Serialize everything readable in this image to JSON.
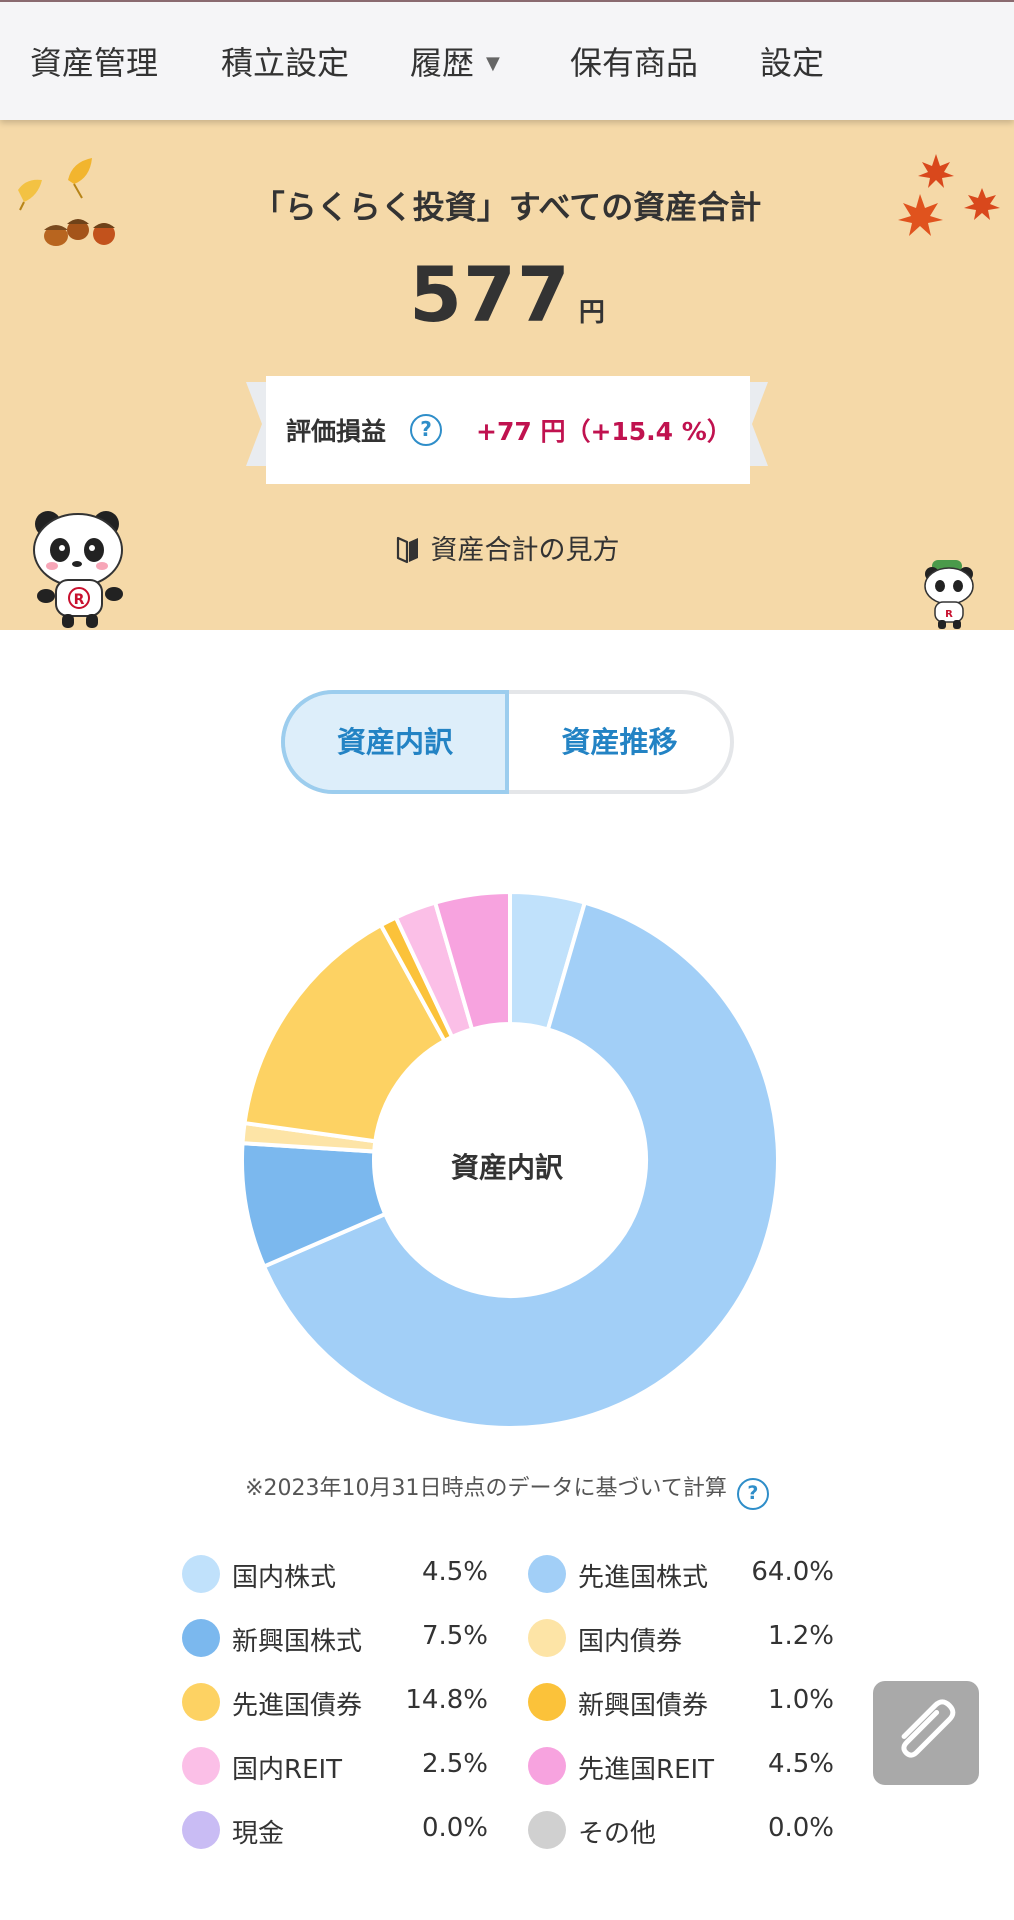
{
  "nav": {
    "items": [
      {
        "label": "資産管理"
      },
      {
        "label": "積立設定"
      },
      {
        "label": "履歴"
      },
      {
        "label": "保有商品"
      },
      {
        "label": "設定"
      }
    ],
    "dropdown_caret": "▼"
  },
  "hero": {
    "title": "「らくらく投資」すべての資産合計",
    "total_value": "577",
    "total_unit": "円",
    "gain_label": "評価損益",
    "help_glyph": "?",
    "gain_value": "+77 円（+15.4 %）",
    "howto_label": "資産合計の見方",
    "bg_color": "#f5d9a8",
    "gain_color": "#c0124f"
  },
  "tabs": {
    "breakdown": "資産内訳",
    "trend": "資産推移"
  },
  "chart": {
    "center_label": "資産内訳",
    "note": "※2023年10月31日時点のデータに基づいて計算"
  },
  "chart_data": {
    "type": "pie",
    "donut": true,
    "categories": [
      "国内株式",
      "先進国株式",
      "新興国株式",
      "国内債券",
      "先進国債券",
      "新興国債券",
      "国内REIT",
      "先進国REIT",
      "現金",
      "その他"
    ],
    "values": [
      4.5,
      64.0,
      7.5,
      1.2,
      14.8,
      1.0,
      2.5,
      4.5,
      0.0,
      0.0
    ],
    "colors": [
      "#c0e1fb",
      "#a2cff7",
      "#7bb8ee",
      "#fde4a6",
      "#fdd263",
      "#fbc23a",
      "#fbbfe7",
      "#f7a3df",
      "#c9bcf4",
      "#d0d0d0"
    ]
  },
  "legend": [
    {
      "name": "国内株式",
      "pct": "4.5%"
    },
    {
      "name": "先進国株式",
      "pct": "64.0%"
    },
    {
      "name": "新興国株式",
      "pct": "7.5%"
    },
    {
      "name": "国内債券",
      "pct": "1.2%"
    },
    {
      "name": "先進国債券",
      "pct": "14.8%"
    },
    {
      "name": "新興国債券",
      "pct": "1.0%"
    },
    {
      "name": "国内REIT",
      "pct": "2.5%"
    },
    {
      "name": "先進国REIT",
      "pct": "4.5%"
    },
    {
      "name": "現金",
      "pct": "0.0%"
    },
    {
      "name": "その他",
      "pct": "0.0%"
    }
  ],
  "icons": {
    "help": "help-circle-icon",
    "book": "book-icon",
    "attachment": "paperclip-icon"
  }
}
